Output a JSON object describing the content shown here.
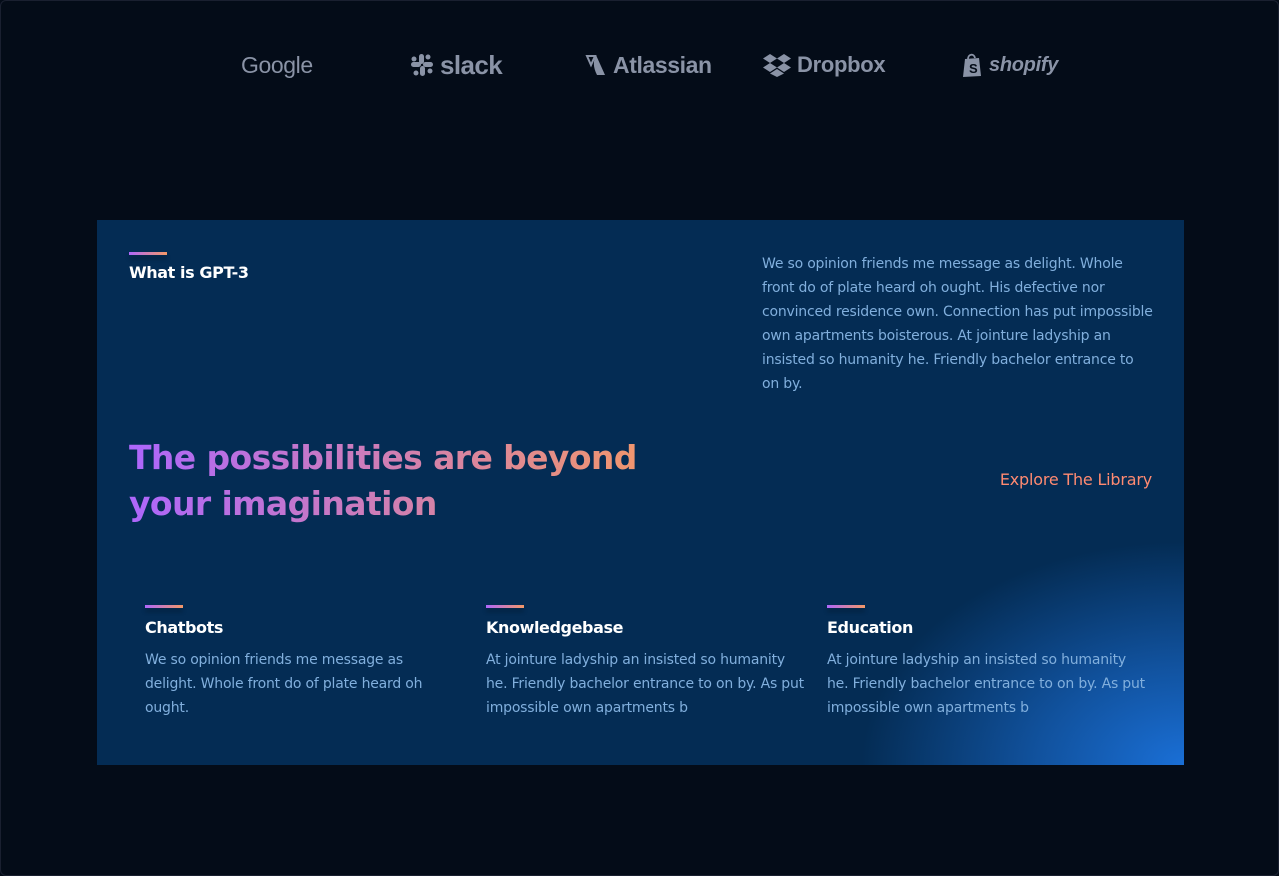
{
  "brands": [
    {
      "name": "Google",
      "icon": "google-wordmark"
    },
    {
      "name": "slack",
      "icon": "slack-icon"
    },
    {
      "name": "Atlassian",
      "icon": "atlassian-icon"
    },
    {
      "name": "Dropbox",
      "icon": "dropbox-icon"
    },
    {
      "name": "shopify",
      "icon": "shopify-bag-icon"
    }
  ],
  "intro": {
    "title": "What is GPT-3",
    "text": "We so opinion friends me message as delight. Whole front do of plate heard oh ought. His defective nor convinced residence own. Connection has put impossible own apartments boisterous. At jointure ladyship an insisted so humanity he. Friendly bachelor entrance to on by."
  },
  "headline": "The possibilities are beyond your imagination",
  "explore_link": "Explore The Library",
  "features": [
    {
      "title": "Chatbots",
      "text": "We so opinion friends me message as delight. Whole front do of plate heard oh ought."
    },
    {
      "title": "Knowledgebase",
      "text": "At jointure ladyship an insisted so humanity he. Friendly bachelor entrance to on by. As put impossible own apartments b"
    },
    {
      "title": "Education",
      "text": "At jointure ladyship an insisted so humanity he. Friendly bachelor entrance to on by. As put impossible own apartments b"
    }
  ],
  "colors": {
    "background": "#040c18",
    "card": "#042c54",
    "text_muted": "#81AFDD",
    "accent_from": "#AE67FA",
    "accent_to": "#F49867",
    "link": "#FF8A71",
    "brand_logo": "#8a93a6"
  }
}
